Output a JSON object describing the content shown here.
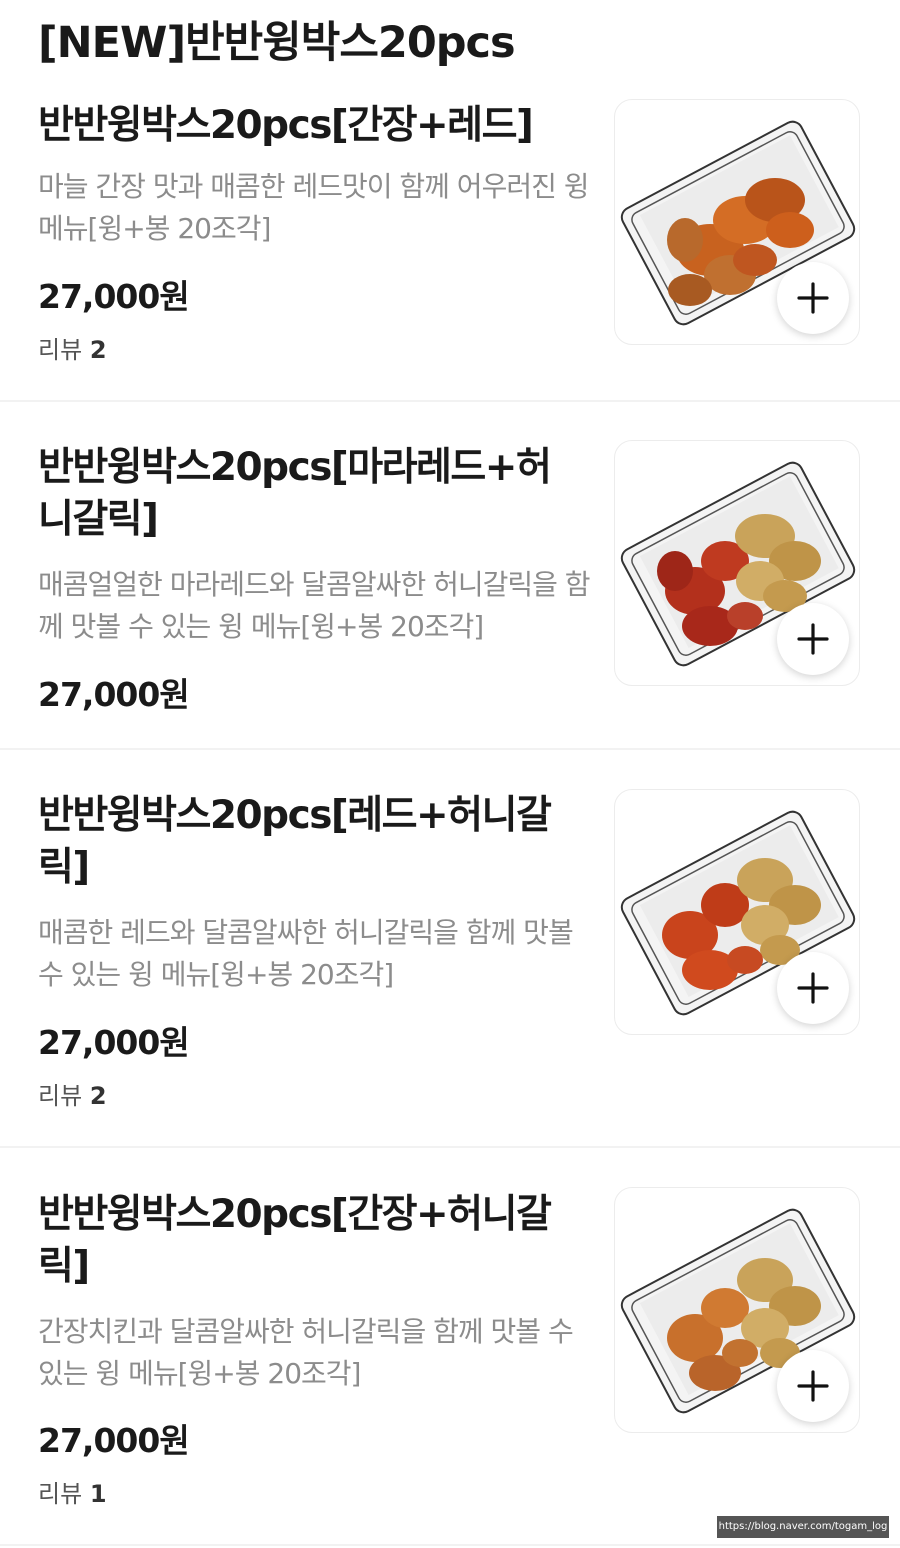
{
  "section": {
    "title": "[NEW]반반윙박스20pcs"
  },
  "items": [
    {
      "name": "반반윙박스20pcs[간장+레드]",
      "description": "마늘 간장 맛과 매콤한 레드맛이 함께 어우러진 윙 메뉴[윙+봉 20조각]",
      "price": "27,000원",
      "review_label": "리뷰",
      "review_count": "2",
      "image_icon": "chicken-wings-soy-red",
      "colors": [
        "#c8621f",
        "#b9541a"
      ]
    },
    {
      "name": "반반윙박스20pcs[마라레드+허니갈릭]",
      "description": "매콤얼얼한 마라레드와 달콤알싸한 허니갈릭을 함께 맛볼 수 있는 윙 메뉴[윙+봉 20조각]",
      "price": "27,000원",
      "image_icon": "chicken-wings-mala-honey-garlic",
      "colors": [
        "#b3301c",
        "#c9a35a"
      ]
    },
    {
      "name": "반반윙박스20pcs[레드+허니갈릭]",
      "description": "매콤한 레드와 달콤알싸한 허니갈릭을 함께 맛볼 수 있는 윙 메뉴[윙+봉 20조각]",
      "price": "27,000원",
      "review_label": "리뷰",
      "review_count": "2",
      "image_icon": "chicken-wings-red-honey-garlic",
      "colors": [
        "#c9441c",
        "#c9a35a"
      ]
    },
    {
      "name": "반반윙박스20pcs[간장+허니갈릭]",
      "description": "간장치킨과 달콤알싸한 허니갈릭을 함께 맛볼 수 있는 윙 메뉴[윙+봉 20조각]",
      "price": "27,000원",
      "review_label": "리뷰",
      "review_count": "1",
      "image_icon": "chicken-wings-soy-honey-garlic",
      "colors": [
        "#c8702c",
        "#c9a35a"
      ]
    }
  ],
  "watermark": "https://blog.naver.com/togam_log"
}
